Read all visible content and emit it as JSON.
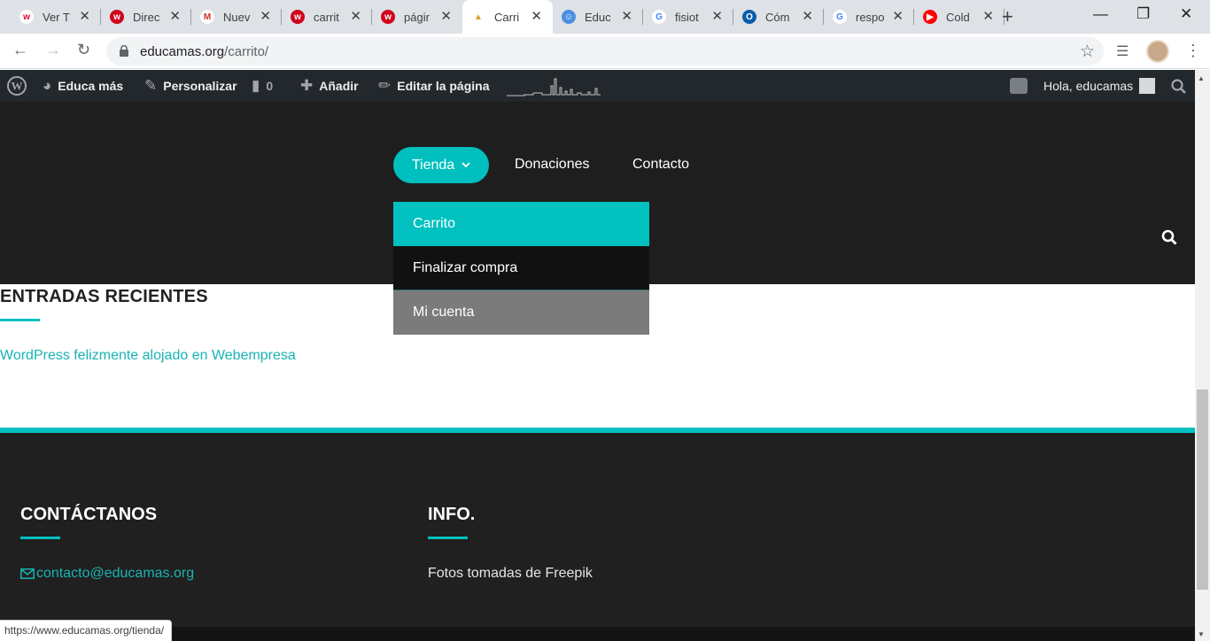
{
  "tabs": [
    {
      "title": "Ver T",
      "fav": "w",
      "color": "#ffffff",
      "fg": "#e4002b"
    },
    {
      "title": "Direc",
      "fav": "w",
      "color": "#d0021b",
      "fg": "#ffffff"
    },
    {
      "title": "Nuev",
      "fav": "M",
      "color": "#ffffff",
      "fg": "#d93025"
    },
    {
      "title": "carrit",
      "fav": "w",
      "color": "#d0021b",
      "fg": "#ffffff"
    },
    {
      "title": "págir",
      "fav": "w",
      "color": "#d0021b",
      "fg": "#ffffff"
    },
    {
      "title": "Carri",
      "fav": "▲",
      "color": "#ffffff",
      "fg": "#e39b2b",
      "active": true
    },
    {
      "title": "Educ",
      "fav": "☺",
      "color": "#4a90e2",
      "fg": "#ffffff"
    },
    {
      "title": "fisiot",
      "fav": "G",
      "color": "#ffffff",
      "fg": "#4285f4"
    },
    {
      "title": "Cóm",
      "fav": "O",
      "color": "#0b5cab",
      "fg": "#ffffff"
    },
    {
      "title": "respo",
      "fav": "G",
      "color": "#ffffff",
      "fg": "#4285f4"
    },
    {
      "title": "Cold",
      "fav": "▶",
      "color": "#ff0000",
      "fg": "#ffffff"
    }
  ],
  "address": {
    "host": "educamas.org",
    "path": "/carrito/"
  },
  "adminbar": {
    "site": "Educa más",
    "customize": "Personalizar",
    "comments": "0",
    "new": "Añadir",
    "edit": "Editar la página",
    "greeting": "Hola, educamas"
  },
  "nav": {
    "shop": "Tienda",
    "donations": "Donaciones",
    "contact": "Contacto",
    "dropdown": [
      "Carrito",
      "Finalizar compra",
      "Mi cuenta"
    ]
  },
  "content": {
    "recent_title": "ENTRADAS RECIENTES",
    "recent_link": "WordPress felizmente alojado en Webempresa"
  },
  "footer": {
    "contact_title": "CONTÁCTANOS",
    "contact_email": "contacto@educamas.org",
    "info_title": "INFO.",
    "info_text": "Fotos tomadas de Freepik"
  },
  "status_url": "https://www.educamas.org/tienda/",
  "colors": {
    "accent": "#00bfbf",
    "adminbar": "#23282d",
    "header": "#1e1e1e"
  }
}
